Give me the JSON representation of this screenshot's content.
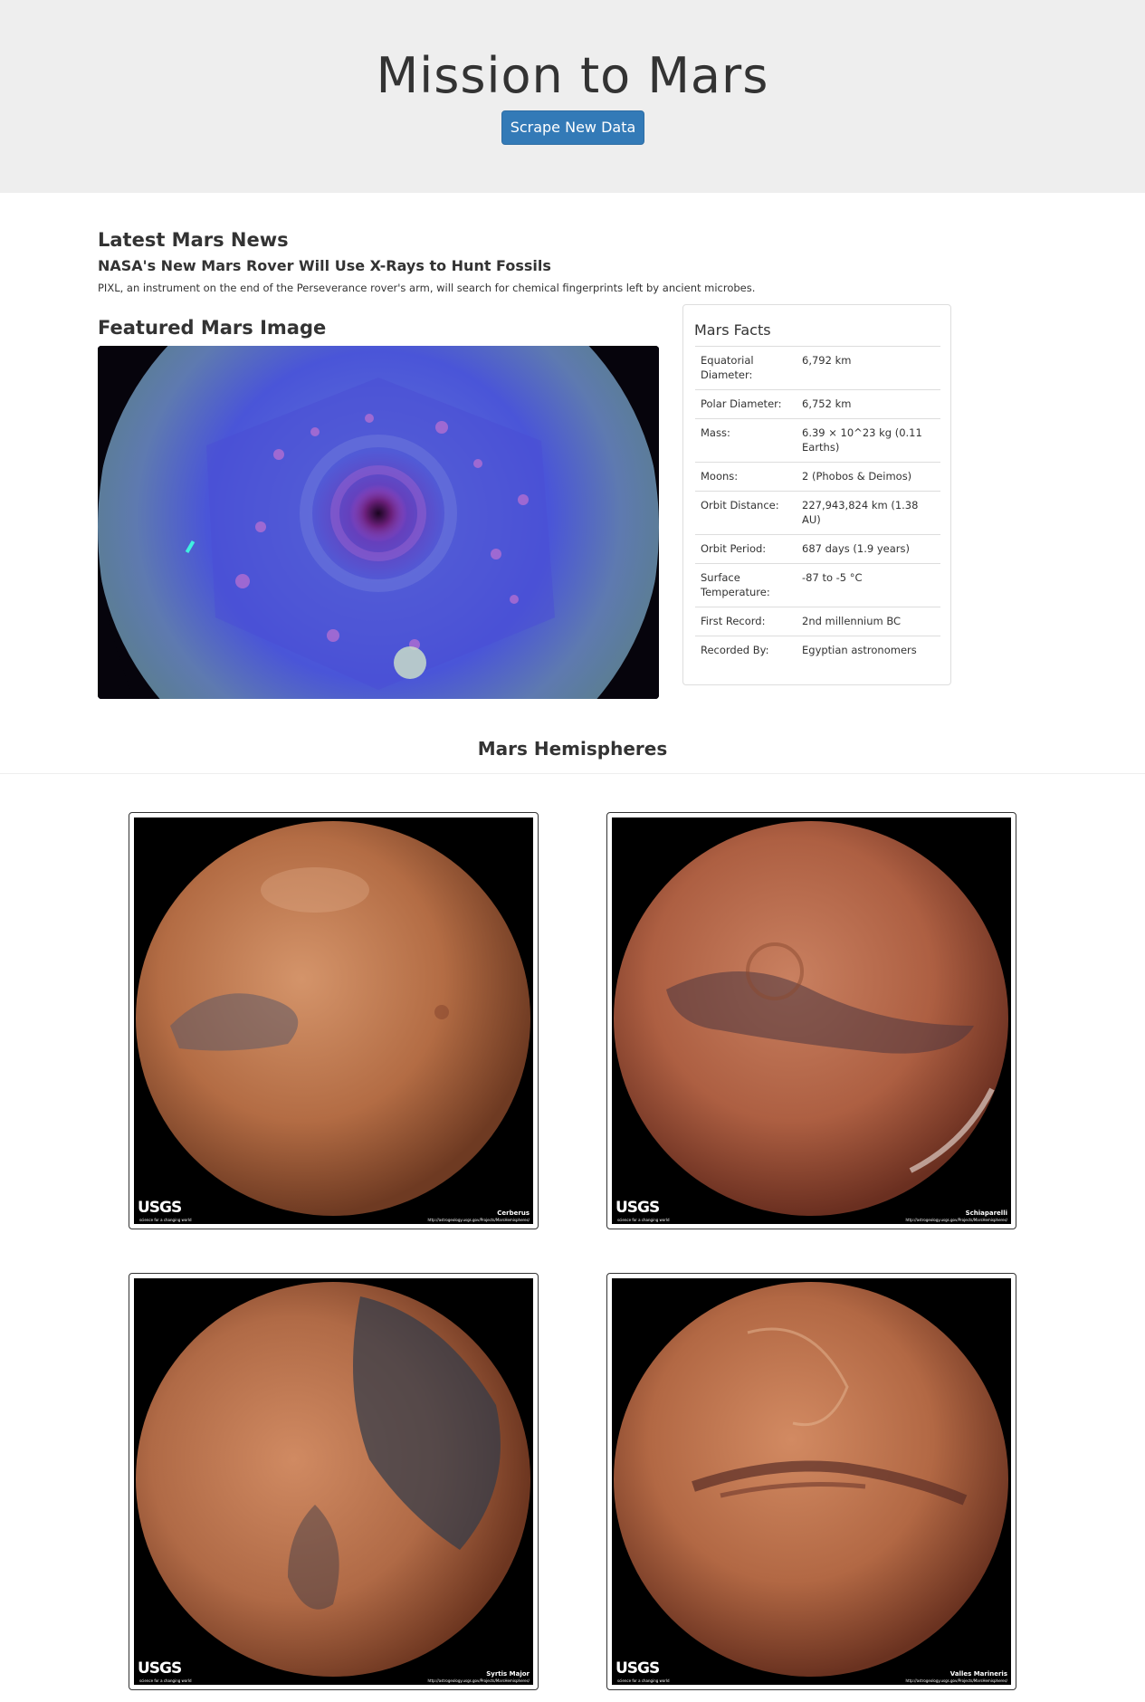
{
  "header": {
    "title": "Mission to Mars",
    "scrape_button": "Scrape New Data"
  },
  "news": {
    "heading": "Latest Mars News",
    "title": "NASA's New Mars Rover Will Use X-Rays to Hunt Fossils",
    "paragraph": "PIXL, an instrument on the end of the Perseverance rover's arm, will search for chemical fingerprints left by ancient microbes."
  },
  "featured": {
    "heading": "Featured Mars Image"
  },
  "facts": {
    "heading": "Mars Facts",
    "rows": [
      {
        "label": "Equatorial Diameter:",
        "value": "6,792 km"
      },
      {
        "label": "Polar Diameter:",
        "value": "6,752 km"
      },
      {
        "label": "Mass:",
        "value": "6.39 × 10^23 kg (0.11 Earths)"
      },
      {
        "label": "Moons:",
        "value": "2 (Phobos & Deimos)"
      },
      {
        "label": "Orbit Distance:",
        "value": "227,943,824 km (1.38 AU)"
      },
      {
        "label": "Orbit Period:",
        "value": "687 days (1.9 years)"
      },
      {
        "label": "Surface Temperature:",
        "value": "-87 to -5 °C"
      },
      {
        "label": "First Record:",
        "value": "2nd millennium BC"
      },
      {
        "label": "Recorded By:",
        "value": "Egyptian astronomers"
      }
    ]
  },
  "hemispheres": {
    "heading": "Mars Hemispheres",
    "logo_text": "USGS",
    "logo_tagline": "science for a changing world",
    "items": [
      {
        "caption": "Cerberus",
        "url": "http://astrogeology.usgs.gov/Projects/MarsHemispheres/"
      },
      {
        "caption": "Schiaparelli",
        "url": "http://astrogeology.usgs.gov/Projects/MarsHemispheres/"
      },
      {
        "caption": "Syrtis Major",
        "url": "http://astrogeology.usgs.gov/Projects/MarsHemispheres/"
      },
      {
        "caption": "Valles Marineris",
        "url": "http://astrogeology.usgs.gov/Projects/MarsHemispheres/"
      }
    ]
  }
}
